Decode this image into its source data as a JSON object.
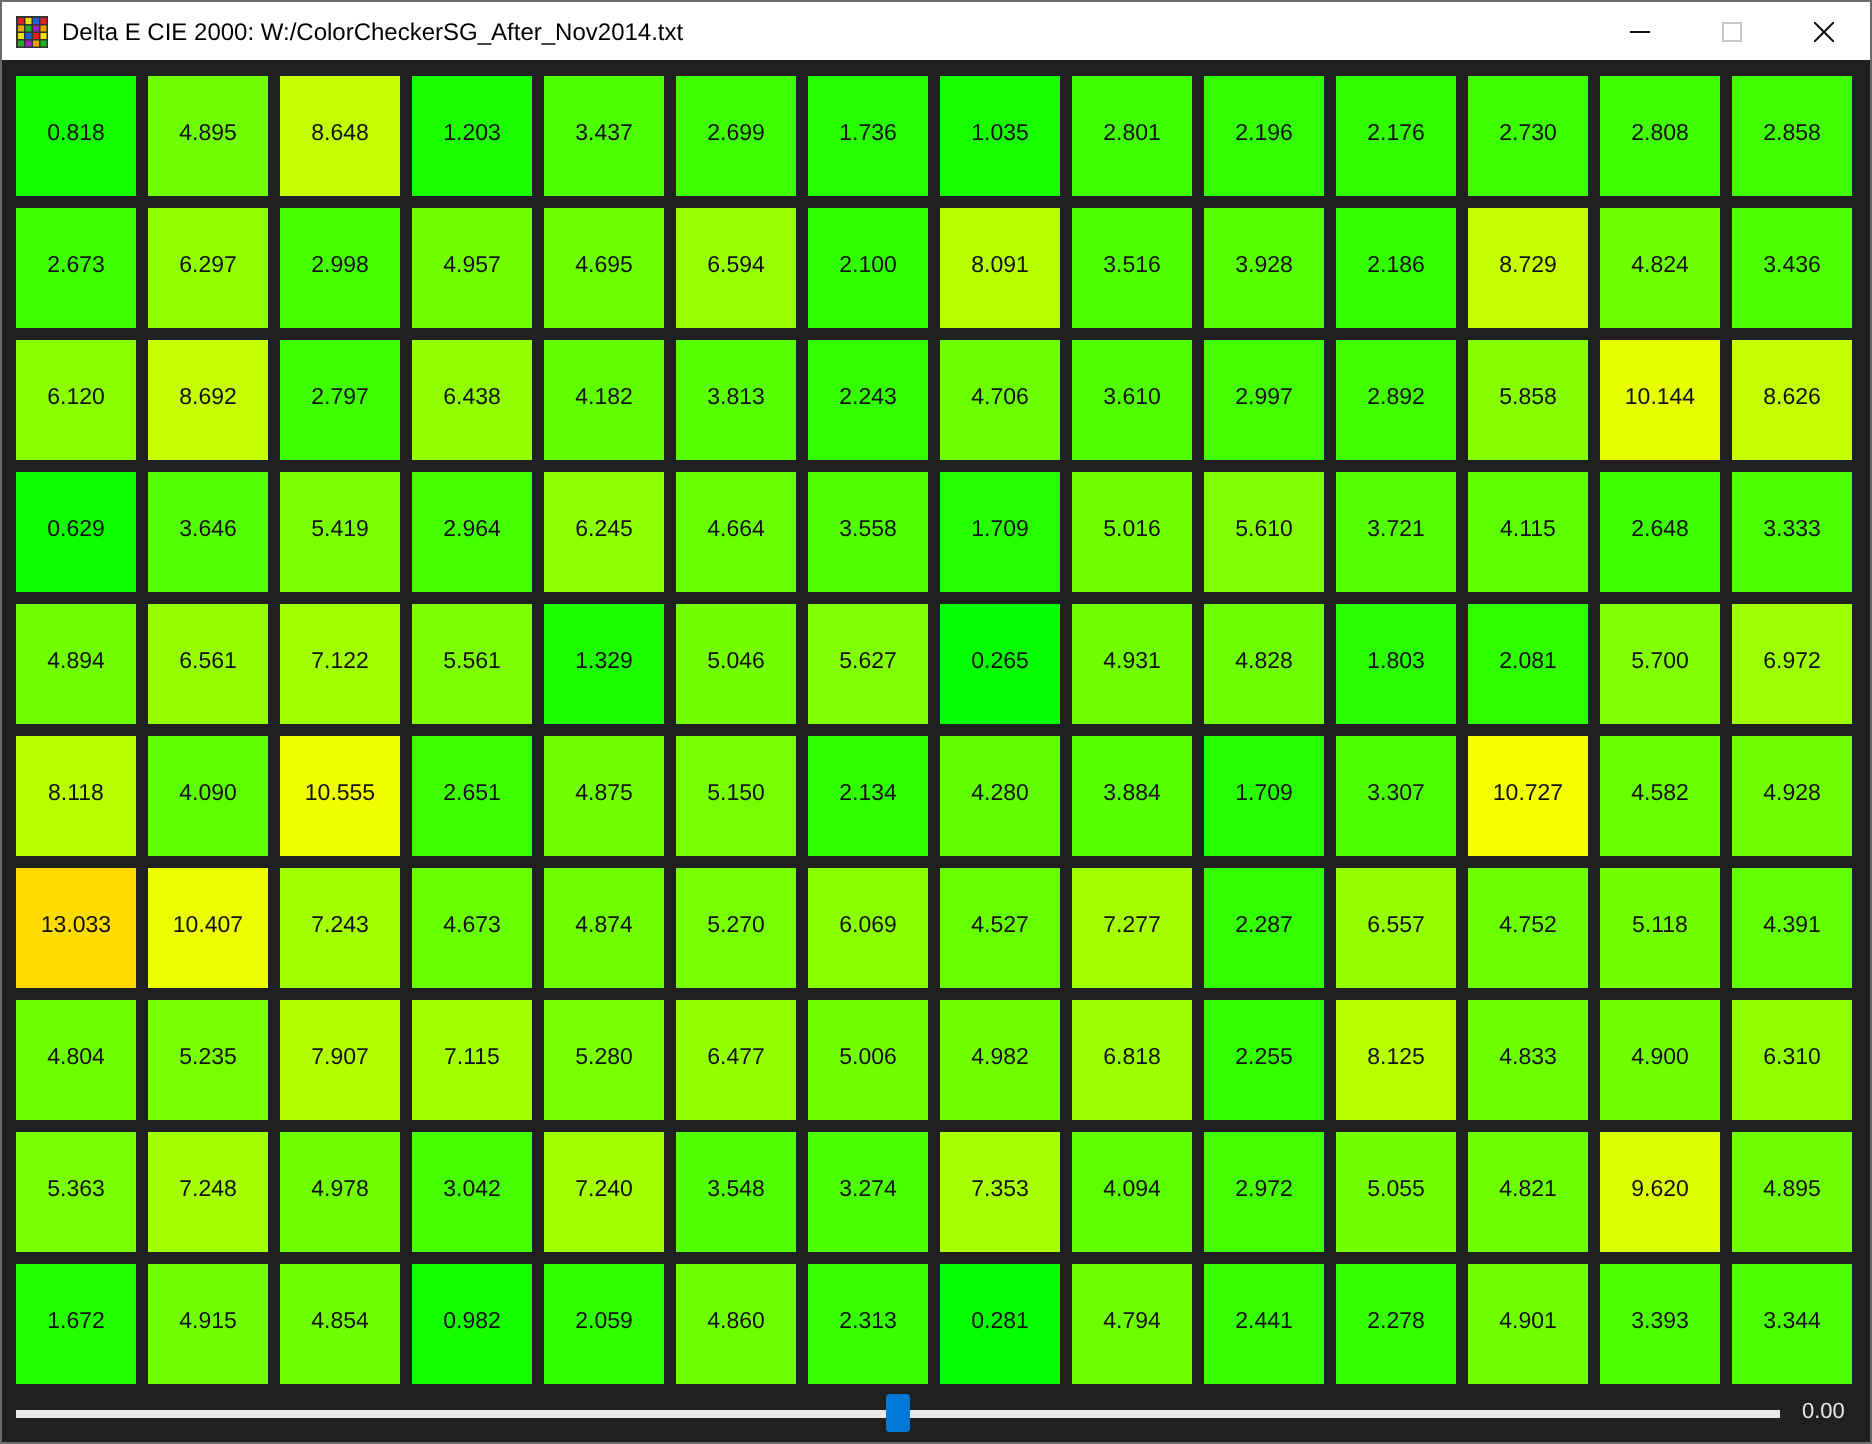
{
  "window": {
    "title": "Delta E CIE 2000: W:/ColorCheckerSG_After_Nov2014.txt",
    "controls": [
      {
        "kind": "minimize",
        "disabled": false
      },
      {
        "kind": "maximize",
        "disabled": true
      },
      {
        "kind": "close",
        "disabled": false
      }
    ]
  },
  "grid": {
    "rows": [
      [
        {
          "value": "0.818",
          "color": "#13ff00"
        },
        {
          "value": "4.895",
          "color": "#6fff00"
        },
        {
          "value": "8.648",
          "color": "#c4ff00"
        },
        {
          "value": "1.203",
          "color": "#1bff00"
        },
        {
          "value": "3.437",
          "color": "#4eff00"
        },
        {
          "value": "2.699",
          "color": "#3dff00"
        },
        {
          "value": "1.736",
          "color": "#27ff00"
        },
        {
          "value": "1.035",
          "color": "#17ff00"
        },
        {
          "value": "2.801",
          "color": "#40ff00"
        },
        {
          "value": "2.196",
          "color": "#32ff00"
        },
        {
          "value": "2.176",
          "color": "#31ff00"
        },
        {
          "value": "2.730",
          "color": "#3eff00"
        },
        {
          "value": "2.808",
          "color": "#40ff00"
        },
        {
          "value": "2.858",
          "color": "#41ff00"
        }
      ],
      [
        {
          "value": "2.673",
          "color": "#3dff00"
        },
        {
          "value": "6.297",
          "color": "#8fff00"
        },
        {
          "value": "2.998",
          "color": "#44ff00"
        },
        {
          "value": "4.957",
          "color": "#71ff00"
        },
        {
          "value": "4.695",
          "color": "#6bff00"
        },
        {
          "value": "6.594",
          "color": "#96ff00"
        },
        {
          "value": "2.100",
          "color": "#30ff00"
        },
        {
          "value": "8.091",
          "color": "#b8ff00"
        },
        {
          "value": "3.516",
          "color": "#50ff00"
        },
        {
          "value": "3.928",
          "color": "#59ff00"
        },
        {
          "value": "2.186",
          "color": "#32ff00"
        },
        {
          "value": "8.729",
          "color": "#c6ff00"
        },
        {
          "value": "4.824",
          "color": "#6eff00"
        },
        {
          "value": "3.436",
          "color": "#4eff00"
        }
      ],
      [
        {
          "value": "6.120",
          "color": "#8bff00"
        },
        {
          "value": "8.692",
          "color": "#c5ff00"
        },
        {
          "value": "2.797",
          "color": "#3fff00"
        },
        {
          "value": "6.438",
          "color": "#92ff00"
        },
        {
          "value": "4.182",
          "color": "#5fff00"
        },
        {
          "value": "3.813",
          "color": "#57ff00"
        },
        {
          "value": "2.243",
          "color": "#33ff00"
        },
        {
          "value": "4.706",
          "color": "#6bff00"
        },
        {
          "value": "3.610",
          "color": "#52ff00"
        },
        {
          "value": "2.997",
          "color": "#44ff00"
        },
        {
          "value": "2.892",
          "color": "#42ff00"
        },
        {
          "value": "5.858",
          "color": "#85ff00"
        },
        {
          "value": "10.144",
          "color": "#e6ff00"
        },
        {
          "value": "8.626",
          "color": "#c4ff00"
        }
      ],
      [
        {
          "value": "0.629",
          "color": "#0eff00"
        },
        {
          "value": "3.646",
          "color": "#53ff00"
        },
        {
          "value": "5.419",
          "color": "#7bff00"
        },
        {
          "value": "2.964",
          "color": "#43ff00"
        },
        {
          "value": "6.245",
          "color": "#8eff00"
        },
        {
          "value": "4.664",
          "color": "#6aff00"
        },
        {
          "value": "3.558",
          "color": "#51ff00"
        },
        {
          "value": "1.709",
          "color": "#27ff00"
        },
        {
          "value": "5.016",
          "color": "#72ff00"
        },
        {
          "value": "5.610",
          "color": "#7fff00"
        },
        {
          "value": "3.721",
          "color": "#54ff00"
        },
        {
          "value": "4.115",
          "color": "#5dff00"
        },
        {
          "value": "2.648",
          "color": "#3cff00"
        },
        {
          "value": "3.333",
          "color": "#4cff00"
        }
      ],
      [
        {
          "value": "4.894",
          "color": "#6fff00"
        },
        {
          "value": "6.561",
          "color": "#95ff00"
        },
        {
          "value": "7.122",
          "color": "#a2ff00"
        },
        {
          "value": "5.561",
          "color": "#7eff00"
        },
        {
          "value": "1.329",
          "color": "#1eff00"
        },
        {
          "value": "5.046",
          "color": "#73ff00"
        },
        {
          "value": "5.627",
          "color": "#80ff00"
        },
        {
          "value": "0.265",
          "color": "#06ff00"
        },
        {
          "value": "4.931",
          "color": "#70ff00"
        },
        {
          "value": "4.828",
          "color": "#6eff00"
        },
        {
          "value": "1.803",
          "color": "#29ff00"
        },
        {
          "value": "2.081",
          "color": "#2fff00"
        },
        {
          "value": "5.700",
          "color": "#81ff00"
        },
        {
          "value": "6.972",
          "color": "#9eff00"
        }
      ],
      [
        {
          "value": "8.118",
          "color": "#b8ff00"
        },
        {
          "value": "4.090",
          "color": "#5dff00"
        },
        {
          "value": "10.555",
          "color": "#f0ff00"
        },
        {
          "value": "2.651",
          "color": "#3cff00"
        },
        {
          "value": "4.875",
          "color": "#6fff00"
        },
        {
          "value": "5.150",
          "color": "#75ff00"
        },
        {
          "value": "2.134",
          "color": "#30ff00"
        },
        {
          "value": "4.280",
          "color": "#61ff00"
        },
        {
          "value": "3.884",
          "color": "#58ff00"
        },
        {
          "value": "1.709",
          "color": "#27ff00"
        },
        {
          "value": "3.307",
          "color": "#4bff00"
        },
        {
          "value": "10.727",
          "color": "#f4ff00"
        },
        {
          "value": "4.582",
          "color": "#68ff00"
        },
        {
          "value": "4.928",
          "color": "#70ff00"
        }
      ],
      [
        {
          "value": "13.033",
          "color": "#ffdb00"
        },
        {
          "value": "10.407",
          "color": "#ecff00"
        },
        {
          "value": "7.243",
          "color": "#a4ff00"
        },
        {
          "value": "4.673",
          "color": "#6aff00"
        },
        {
          "value": "4.874",
          "color": "#6fff00"
        },
        {
          "value": "5.270",
          "color": "#78ff00"
        },
        {
          "value": "6.069",
          "color": "#8aff00"
        },
        {
          "value": "4.527",
          "color": "#67ff00"
        },
        {
          "value": "7.277",
          "color": "#a5ff00"
        },
        {
          "value": "2.287",
          "color": "#34ff00"
        },
        {
          "value": "6.557",
          "color": "#95ff00"
        },
        {
          "value": "4.752",
          "color": "#6cff00"
        },
        {
          "value": "5.118",
          "color": "#74ff00"
        },
        {
          "value": "4.391",
          "color": "#64ff00"
        }
      ],
      [
        {
          "value": "4.804",
          "color": "#6dff00"
        },
        {
          "value": "5.235",
          "color": "#77ff00"
        },
        {
          "value": "7.907",
          "color": "#b3ff00"
        },
        {
          "value": "7.115",
          "color": "#a2ff00"
        },
        {
          "value": "5.280",
          "color": "#78ff00"
        },
        {
          "value": "6.477",
          "color": "#93ff00"
        },
        {
          "value": "5.006",
          "color": "#72ff00"
        },
        {
          "value": "4.982",
          "color": "#71ff00"
        },
        {
          "value": "6.818",
          "color": "#9bff00"
        },
        {
          "value": "2.255",
          "color": "#33ff00"
        },
        {
          "value": "8.125",
          "color": "#b8ff00"
        },
        {
          "value": "4.833",
          "color": "#6eff00"
        },
        {
          "value": "4.900",
          "color": "#6fff00"
        },
        {
          "value": "6.310",
          "color": "#8fff00"
        }
      ],
      [
        {
          "value": "5.363",
          "color": "#7aff00"
        },
        {
          "value": "7.248",
          "color": "#a5ff00"
        },
        {
          "value": "4.978",
          "color": "#71ff00"
        },
        {
          "value": "3.042",
          "color": "#45ff00"
        },
        {
          "value": "7.240",
          "color": "#a4ff00"
        },
        {
          "value": "3.548",
          "color": "#51ff00"
        },
        {
          "value": "3.274",
          "color": "#4aff00"
        },
        {
          "value": "7.353",
          "color": "#a7ff00"
        },
        {
          "value": "4.094",
          "color": "#5dff00"
        },
        {
          "value": "2.972",
          "color": "#43ff00"
        },
        {
          "value": "5.055",
          "color": "#73ff00"
        },
        {
          "value": "4.821",
          "color": "#6dff00"
        },
        {
          "value": "9.620",
          "color": "#daff00"
        },
        {
          "value": "4.895",
          "color": "#6fff00"
        }
      ],
      [
        {
          "value": "1.672",
          "color": "#26ff00"
        },
        {
          "value": "4.915",
          "color": "#70ff00"
        },
        {
          "value": "4.854",
          "color": "#6eff00"
        },
        {
          "value": "0.982",
          "color": "#16ff00"
        },
        {
          "value": "2.059",
          "color": "#2fff00"
        },
        {
          "value": "4.860",
          "color": "#6eff00"
        },
        {
          "value": "2.313",
          "color": "#35ff00"
        },
        {
          "value": "0.281",
          "color": "#06ff00"
        },
        {
          "value": "4.794",
          "color": "#6dff00"
        },
        {
          "value": "2.441",
          "color": "#37ff00"
        },
        {
          "value": "2.278",
          "color": "#34ff00"
        },
        {
          "value": "4.901",
          "color": "#6fff00"
        },
        {
          "value": "3.393",
          "color": "#4dff00"
        },
        {
          "value": "3.344",
          "color": "#4cff00"
        }
      ]
    ]
  },
  "slider": {
    "level": 0.5,
    "reading": "0.00"
  }
}
